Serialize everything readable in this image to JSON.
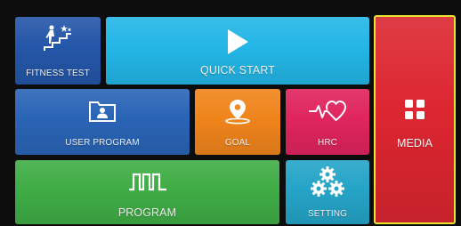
{
  "tiles": {
    "fitness_test": {
      "label": "FITNESS TEST",
      "icon": "stairs-stars-icon"
    },
    "quick_start": {
      "label": "QUICK START",
      "icon": "play-icon"
    },
    "media": {
      "label": "MEDIA",
      "icon": "grid-icon"
    },
    "user_program": {
      "label": "USER PROGRAM",
      "icon": "user-folder-icon"
    },
    "goal": {
      "label": "GOAL",
      "icon": "location-pin-icon"
    },
    "hrc": {
      "label": "HRC",
      "icon": "heartbeat-icon"
    },
    "program": {
      "label": "PROGRAM",
      "icon": "square-wave-icon"
    },
    "setting": {
      "label": "SETTING",
      "icon": "gears-icon"
    }
  },
  "colors": {
    "background": "#0d0d0d",
    "fitness_test": "#2456a8",
    "quick_start": "#23b6e6",
    "media": "#dc2630",
    "media_selected_border": "#e8e62c",
    "user_program": "#2a64b6",
    "goal": "#f0841b",
    "hrc": "#e0245e",
    "program": "#3fad45",
    "setting": "#25a4c7"
  }
}
